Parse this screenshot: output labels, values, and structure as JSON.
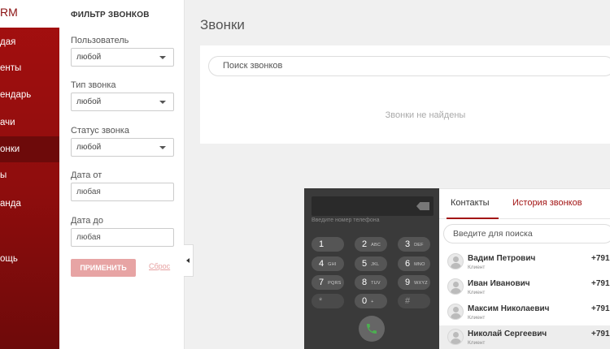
{
  "sidebar": {
    "brand": "RM",
    "items": [
      {
        "label": "дая",
        "active": false
      },
      {
        "label": "енты",
        "active": false
      },
      {
        "label": "ендарь",
        "active": false
      },
      {
        "label": "ачи",
        "active": false
      },
      {
        "label": "онки",
        "active": true
      },
      {
        "label": "ы",
        "active": false
      },
      {
        "label": "анда",
        "active": false
      },
      {
        "label": "ощь",
        "active": false
      }
    ]
  },
  "filter": {
    "title": "ФИЛЬТР ЗВОНКОВ",
    "user": {
      "label": "Пользователь",
      "value": "любой"
    },
    "call_type": {
      "label": "Тип звонка",
      "value": "любой"
    },
    "call_status": {
      "label": "Статус звонка",
      "value": "любой"
    },
    "date_from": {
      "label": "Дата от",
      "value": "любая"
    },
    "date_to": {
      "label": "Дата до",
      "value": "любая"
    },
    "apply_label": "ПРИМЕНИТЬ",
    "reset_label": "Сброс"
  },
  "main": {
    "title": "Звонки",
    "search_placeholder": "Поиск звонков",
    "empty_message": "Звонки не найдены"
  },
  "phone": {
    "input_hint": "Введите номер телефона",
    "keys": [
      {
        "digit": "1",
        "letters": ""
      },
      {
        "digit": "2",
        "letters": "ABC"
      },
      {
        "digit": "3",
        "letters": "DEF"
      },
      {
        "digit": "4",
        "letters": "GHI"
      },
      {
        "digit": "5",
        "letters": "JKL"
      },
      {
        "digit": "6",
        "letters": "MNO"
      },
      {
        "digit": "7",
        "letters": "PQRS"
      },
      {
        "digit": "8",
        "letters": "TUV"
      },
      {
        "digit": "9",
        "letters": "WXYZ"
      },
      {
        "digit": "*",
        "letters": ""
      },
      {
        "digit": "0",
        "letters": "+"
      },
      {
        "digit": "#",
        "letters": ""
      }
    ],
    "tabs": {
      "contacts": "Контакты",
      "history": "История звонков"
    },
    "contacts_search_placeholder": "Введите для поиска",
    "contacts": [
      {
        "name": "Вадим Петрович",
        "role": "Клиент",
        "phone": "+791"
      },
      {
        "name": "Иван Иванович",
        "role": "Клиент",
        "phone": "+791"
      },
      {
        "name": "Максим Николаевич",
        "role": "Клиент",
        "phone": "+791"
      },
      {
        "name": "Николай Сергеевич",
        "role": "Клиент",
        "phone": "+791",
        "selected": true
      }
    ]
  },
  "colors": {
    "brand_red": "#a31515",
    "sidebar_dark": "#6d0a0a",
    "apply_disabled": "#e7a4a4",
    "dialpad_bg": "#3a3a3a"
  }
}
